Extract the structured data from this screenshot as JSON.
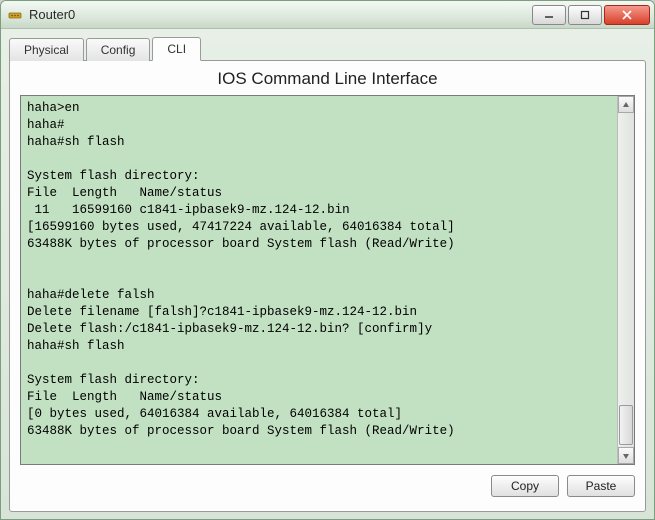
{
  "window": {
    "title": "Router0"
  },
  "tabs": {
    "physical": "Physical",
    "config": "Config",
    "cli": "CLI"
  },
  "panel": {
    "title": "IOS Command Line Interface"
  },
  "terminal": {
    "content": "haha>en\nhaha#\nhaha#sh flash\n\nSystem flash directory:\nFile  Length   Name/status\n 11   16599160 c1841-ipbasek9-mz.124-12.bin\n[16599160 bytes used, 47417224 available, 64016384 total]\n63488K bytes of processor board System flash (Read/Write)\n\n\nhaha#delete falsh\nDelete filename [falsh]?c1841-ipbasek9-mz.124-12.bin\nDelete flash:/c1841-ipbasek9-mz.124-12.bin? [confirm]y\nhaha#sh flash\n\nSystem flash directory:\nFile  Length   Name/status\n[0 bytes used, 64016384 available, 64016384 total]\n63488K bytes of processor board System flash (Read/Write)\n\n\nhaha#"
  },
  "buttons": {
    "copy": "Copy",
    "paste": "Paste"
  }
}
